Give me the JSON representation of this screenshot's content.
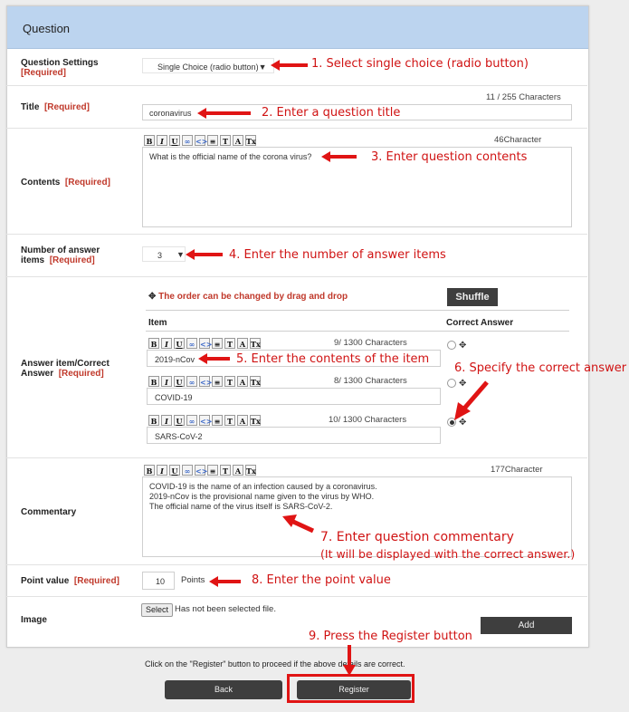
{
  "panel": {
    "title": "Question"
  },
  "question_settings": {
    "label": "Question Settings",
    "required": "[Required]",
    "value": "Single Choice (radio button)",
    "caret": "▼"
  },
  "title": {
    "label": "Title",
    "required": "[Required]",
    "count": "11 / 255 Characters",
    "value": "coronavirus"
  },
  "contents": {
    "label": "Contents",
    "required": "[Required]",
    "count": "46Character",
    "value": "What is the official name of the corona virus?"
  },
  "answer_count": {
    "label_line1": "Number of answer",
    "label_line2": "items",
    "required": "[Required]",
    "value": "3",
    "caret": "▼"
  },
  "answers": {
    "label_line1": "Answer item/Correct",
    "label_line2": "Answer",
    "required": "[Required]",
    "hint": "The order can be changed by drag and drop",
    "shuffle": "Shuffle",
    "col_item": "Item",
    "col_correct": "Correct Answer",
    "items": [
      {
        "count": "9/ 1300 Characters",
        "value": "2019-nCov"
      },
      {
        "count": "8/ 1300 Characters",
        "value": "COVID-19"
      },
      {
        "count": "10/ 1300 Characters",
        "value": "SARS-CoV-2"
      }
    ]
  },
  "commentary": {
    "label": "Commentary",
    "count": "177Character",
    "lines": [
      "COVID-19 is the name of an infection caused by a coronavirus.",
      "2019-nCov is the provisional name given to the virus by WHO.",
      "The official name of the virus itself is SARS-CoV-2."
    ]
  },
  "point_value": {
    "label": "Point value",
    "required": "[Required]",
    "value": "10",
    "unit": "Points"
  },
  "image": {
    "label": "Image",
    "select": "Select",
    "status": "Has not been selected file.",
    "add": "Add"
  },
  "footer": {
    "note": "Click on the \"Register\" button to proceed if the above details are correct.",
    "back": "Back",
    "register": "Register"
  },
  "annotations": {
    "a1": "1. Select single choice (radio button)",
    "a2": "2. Enter a question title",
    "a3": "3. Enter question contents",
    "a4": "4. Enter the number of answer items",
    "a5": "5. Enter the contents of the item",
    "a6": "6. Specify the correct answer",
    "a7": "7. Enter question commentary",
    "a7b": "(It will be displayed with the correct answer.)",
    "a8": "8. Enter the point value",
    "a9": "9. Press the Register button"
  },
  "colors": {
    "header": "#bcd4ef",
    "required": "#c0392b",
    "annotation": "#d01313"
  }
}
